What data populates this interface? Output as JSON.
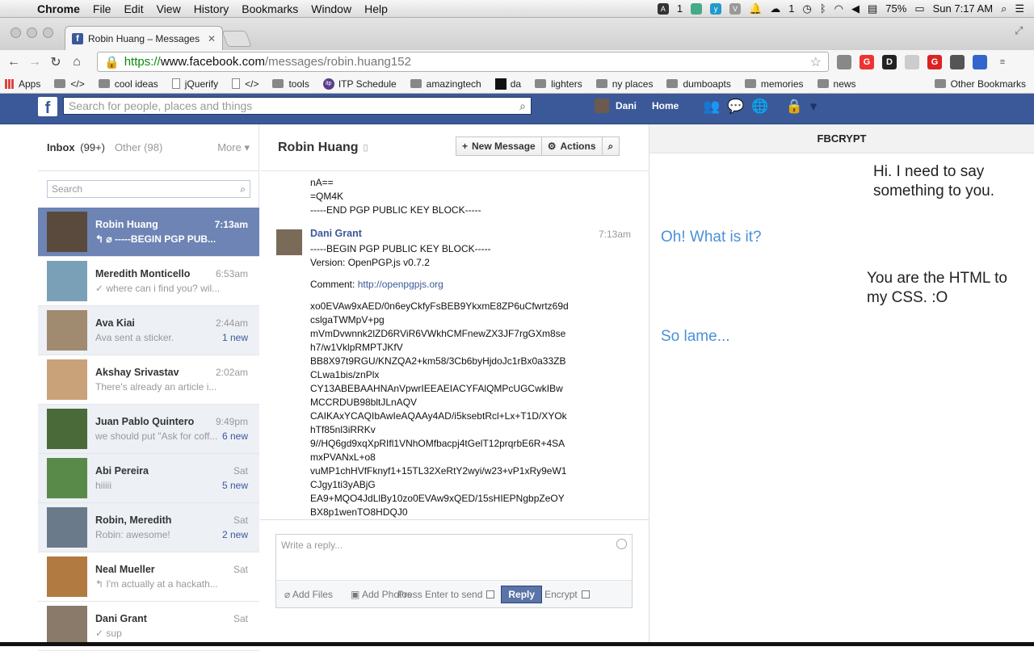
{
  "menubar": {
    "app": "Chrome",
    "items": [
      "File",
      "Edit",
      "View",
      "History",
      "Bookmarks",
      "Window",
      "Help"
    ],
    "status": {
      "battery": "75%",
      "clock": "Sun 7:17 AM",
      "notif_count": "1",
      "dropbox_count": "1"
    }
  },
  "browser": {
    "tab_title": "Robin Huang – Messages",
    "url_scheme": "https://",
    "url_host": "www.facebook.com",
    "url_path": "/messages/robin.huang152",
    "bookmarks": [
      {
        "label": "Apps",
        "icon": "grid-icon"
      },
      {
        "label": "</>",
        "icon": "folder-icon"
      },
      {
        "label": "cool ideas",
        "icon": "folder-icon"
      },
      {
        "label": "jQuerify",
        "icon": "page-icon"
      },
      {
        "label": "</>",
        "icon": "page-icon"
      },
      {
        "label": "tools",
        "icon": "folder-icon"
      },
      {
        "label": "ITP Schedule",
        "icon": "itp-icon"
      },
      {
        "label": "amazingtech",
        "icon": "folder-icon"
      },
      {
        "label": "da",
        "icon": "da-icon"
      },
      {
        "label": "lighters",
        "icon": "folder-icon"
      },
      {
        "label": "ny places",
        "icon": "folder-icon"
      },
      {
        "label": "dumboapts",
        "icon": "folder-icon"
      },
      {
        "label": "memories",
        "icon": "folder-icon"
      },
      {
        "label": "news",
        "icon": "folder-icon"
      }
    ],
    "other_bookmarks": "Other Bookmarks"
  },
  "fb": {
    "search_placeholder": "Search for people, places and things",
    "user": "Dani",
    "home": "Home"
  },
  "inbox": {
    "inbox_label": "Inbox",
    "inbox_count": "(99+)",
    "other_label": "Other",
    "other_count": "(98)",
    "more_label": "More",
    "search_placeholder": "Search",
    "threads": [
      {
        "name": "Robin Huang",
        "time": "7:13am",
        "snippet": "↰ ⌀ -----BEGIN PGP PUB...",
        "new": ""
      },
      {
        "name": "Meredith Monticello",
        "time": "6:53am",
        "snippet": "✓ where can i find you? wil...",
        "new": ""
      },
      {
        "name": "Ava Kiai",
        "time": "2:44am",
        "snippet": "Ava sent a sticker.",
        "new": "1 new"
      },
      {
        "name": "Akshay Srivastav",
        "time": "2:02am",
        "snippet": "There's already an article i...",
        "new": ""
      },
      {
        "name": "Juan Pablo Quintero",
        "time": "9:49pm",
        "snippet": "we should put \"Ask for coff...",
        "new": "6 new"
      },
      {
        "name": "Abi Pereira",
        "time": "Sat",
        "snippet": "hiiiii",
        "new": "5 new"
      },
      {
        "name": "Robin, Meredith",
        "time": "Sat",
        "snippet": "Robin: awesome!",
        "new": "2 new"
      },
      {
        "name": "Neal Mueller",
        "time": "Sat",
        "snippet": "↰ I'm actually at a hackath...",
        "new": ""
      },
      {
        "name": "Dani Grant",
        "time": "Sat",
        "snippet": "✓ sup",
        "new": ""
      }
    ]
  },
  "conversation": {
    "name": "Robin Huang",
    "new_message": "New Message",
    "actions": "Actions",
    "prev_tail": [
      "nA==",
      "=QM4K",
      "-----END PGP PUBLIC KEY BLOCK-----"
    ],
    "sender": "Dani Grant",
    "sent_time": "7:13am",
    "header_lines": [
      "-----BEGIN PGP PUBLIC KEY BLOCK-----",
      "Version: OpenPGP.js v0.7.2"
    ],
    "comment_label": "Comment:",
    "comment_link": "http://openpgpjs.org",
    "key_lines": [
      "xo0EVAw9xAED/0n6eyCkfyFsBEB9YkxmE8ZP6uCfwrtz69d",
      "cslgaTWMpV+pg",
      "mVmDvwnnk2lZD6RViR6VWkhCMFnewZX3JF7rgGXm8se",
      "h7/w1VklpRMPTJKfV",
      "BB8X97t9RGU/KNZQA2+km58/3Cb6byHjdoJc1rBx0a33ZB",
      "CLwa1bis/znPlx",
      "CY13ABEBAAHNAnVpwrIEEAEIACYFAlQMPcUGCwkIBw",
      "MCCRDUB98bltJLnAQV",
      "CAIKAxYCAQIbAwIeAQAAy4AD/i5ksebtRcl+Lx+T1D/XYOk",
      "hTf85nl3iRRKv",
      "9//HQ6gd9xqXpRIfl1VNhOMfbacpj4tGelT12prqrbE6R+4SA",
      "mxPVANxL+o8",
      "vuMP1chHVfFknyf1+15TL32XeRtY2wyi/w23+vP1xRy9eW1",
      "CJgy1ti3yABjG",
      "EA9+MQO4JdLlBy10zo0EVAw9xQED/15sHIEPNgbpZeOY",
      "BX8p1wenTO8HDQJ0"
    ],
    "reply_placeholder": "Write a reply...",
    "add_files": "Add Files",
    "add_photos": "Add Photos",
    "press_enter": "Press Enter to send",
    "reply": "Reply",
    "encrypt": "Encrypt"
  },
  "fbcrypt": {
    "title": "FBCRYPT",
    "messages": [
      {
        "from": "me",
        "line1": "Hi. I need to say",
        "line2": "something to you."
      },
      {
        "from": "them",
        "line1": "Oh! What is it?",
        "line2": ""
      },
      {
        "from": "me",
        "line1": "You are the HTML to",
        "line2": "my CSS. :O"
      },
      {
        "from": "them",
        "line1": "So lame...",
        "line2": ""
      }
    ]
  },
  "colors": {
    "fb_blue": "#3b5998",
    "selected_thread": "#6d84b4",
    "fbcrypt_reply": "#4a90d9"
  }
}
